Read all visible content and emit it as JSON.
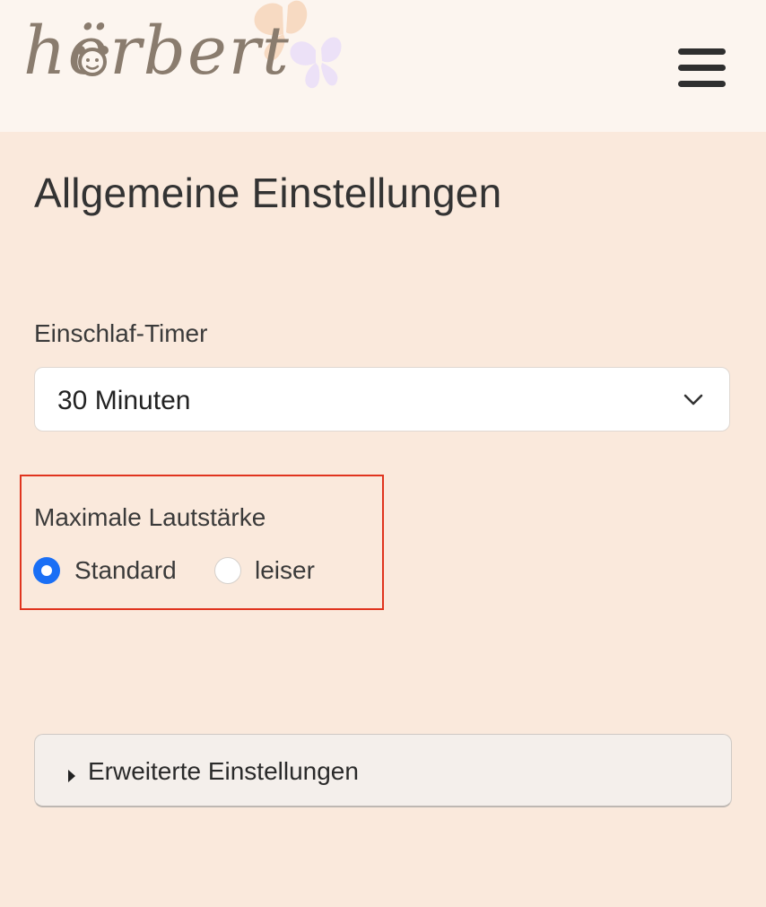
{
  "header": {
    "logo_text": "hörbert",
    "menu_icon": "hamburger-menu-icon"
  },
  "main": {
    "title": "Allgemeine Einstellungen",
    "sleep_timer": {
      "label": "Einschlaf-Timer",
      "selected": "30 Minuten",
      "icon": "chevron-down-icon"
    },
    "max_volume": {
      "label": "Maximale Lautstärke",
      "options": [
        {
          "label": "Standard",
          "checked": true
        },
        {
          "label": "leiser",
          "checked": false
        }
      ]
    },
    "advanced": {
      "label": "Erweiterte Einstellungen",
      "icon": "caret-right-icon"
    }
  },
  "colors": {
    "page_background": "#fae9dc",
    "header_background": "#fcf5ef",
    "accent_radio": "#1a6ff5",
    "highlight_border": "#e0341e",
    "logo_text": "#8a7c6e",
    "butterfly_peach": "#f7d9c0",
    "butterfly_lilac": "#ece0f8"
  }
}
